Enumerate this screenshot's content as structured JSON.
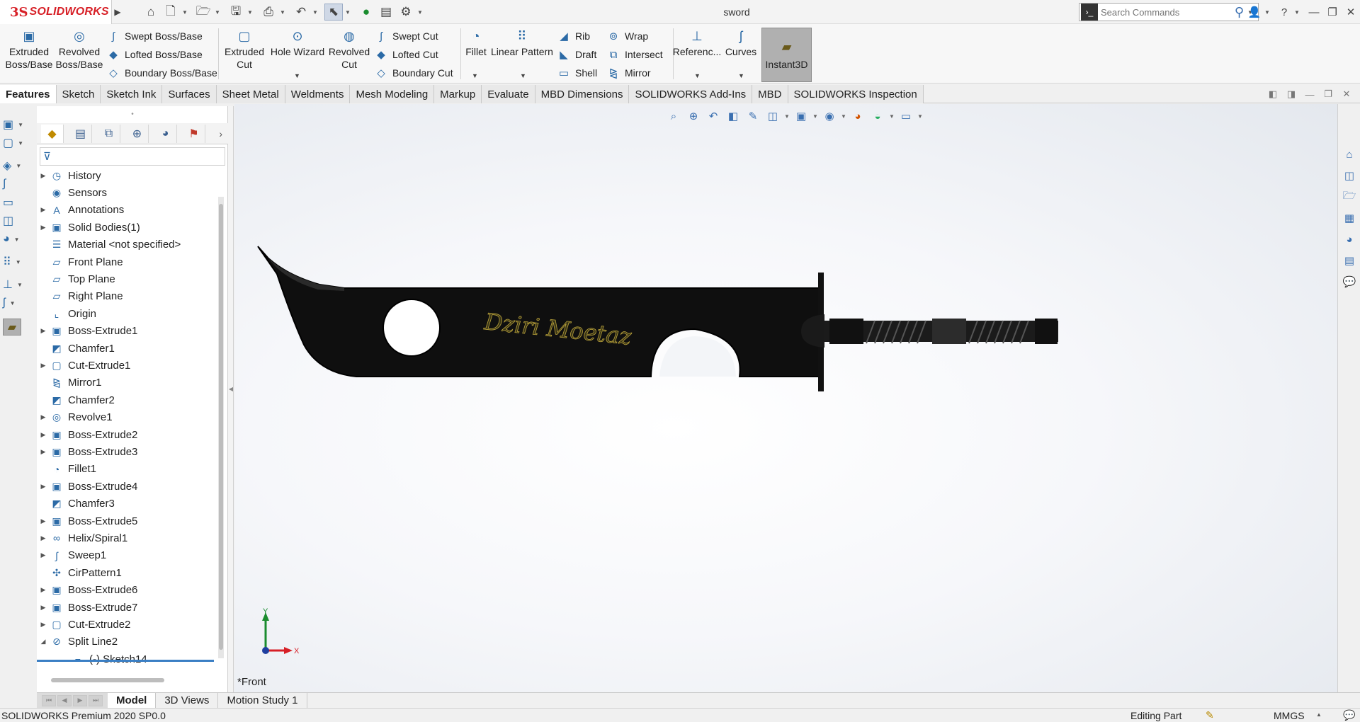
{
  "titlebar": {
    "logo_mark": "3S",
    "logo_text": "SOLIDWORKS",
    "document_title": "sword",
    "search": {
      "placeholder": "Search Commands"
    },
    "icons": [
      "home-icon",
      "new-document-icon",
      "open-icon",
      "save-icon",
      "print-icon",
      "undo-icon",
      "select-icon",
      "rebuild-icon",
      "file-properties-icon",
      "options-icon"
    ]
  },
  "ribbon": {
    "extruded_boss": "Extruded\nBoss/Base",
    "revolved_boss": "Revolved\nBoss/Base",
    "swept_boss": "Swept Boss/Base",
    "lofted_boss": "Lofted Boss/Base",
    "boundary_boss": "Boundary Boss/Base",
    "extruded_cut": "Extruded\nCut",
    "hole_wizard": "Hole Wizard",
    "revolved_cut": "Revolved\nCut",
    "swept_cut": "Swept Cut",
    "lofted_cut": "Lofted Cut",
    "boundary_cut": "Boundary Cut",
    "fillet": "Fillet",
    "linear_pattern": "Linear Pattern",
    "rib": "Rib",
    "draft": "Draft",
    "shell": "Shell",
    "wrap": "Wrap",
    "intersect": "Intersect",
    "mirror": "Mirror",
    "reference": "Referenc...",
    "curves": "Curves",
    "instant3d": "Instant3D"
  },
  "tabs": [
    "Features",
    "Sketch",
    "Sketch Ink",
    "Surfaces",
    "Sheet Metal",
    "Weldments",
    "Mesh Modeling",
    "Markup",
    "Evaluate",
    "MBD Dimensions",
    "SOLIDWORKS Add-Ins",
    "MBD",
    "SOLIDWORKS Inspection"
  ],
  "tree": [
    {
      "label": "History",
      "icon": "history-icon",
      "expandable": true
    },
    {
      "label": "Sensors",
      "icon": "sensors-icon",
      "expandable": false
    },
    {
      "label": "Annotations",
      "icon": "annotations-icon",
      "expandable": true
    },
    {
      "label": "Solid Bodies(1)",
      "icon": "solid-bodies-icon",
      "expandable": true
    },
    {
      "label": "Material <not specified>",
      "icon": "material-icon",
      "expandable": false
    },
    {
      "label": "Front Plane",
      "icon": "plane-icon",
      "expandable": false
    },
    {
      "label": "Top Plane",
      "icon": "plane-icon",
      "expandable": false
    },
    {
      "label": "Right Plane",
      "icon": "plane-icon",
      "expandable": false
    },
    {
      "label": "Origin",
      "icon": "origin-icon",
      "expandable": false
    },
    {
      "label": "Boss-Extrude1",
      "icon": "extrude-icon",
      "expandable": true
    },
    {
      "label": "Chamfer1",
      "icon": "chamfer-icon",
      "expandable": false
    },
    {
      "label": "Cut-Extrude1",
      "icon": "cut-extrude-icon",
      "expandable": true
    },
    {
      "label": "Mirror1",
      "icon": "mirror-icon",
      "expandable": false
    },
    {
      "label": "Chamfer2",
      "icon": "chamfer-icon",
      "expandable": false
    },
    {
      "label": "Revolve1",
      "icon": "revolve-icon",
      "expandable": true
    },
    {
      "label": "Boss-Extrude2",
      "icon": "extrude-icon",
      "expandable": true
    },
    {
      "label": "Boss-Extrude3",
      "icon": "extrude-icon",
      "expandable": true
    },
    {
      "label": "Fillet1",
      "icon": "fillet-icon",
      "expandable": false
    },
    {
      "label": "Boss-Extrude4",
      "icon": "extrude-icon",
      "expandable": true
    },
    {
      "label": "Chamfer3",
      "icon": "chamfer-icon",
      "expandable": false
    },
    {
      "label": "Boss-Extrude5",
      "icon": "extrude-icon",
      "expandable": true
    },
    {
      "label": "Helix/Spiral1",
      "icon": "helix-icon",
      "expandable": true
    },
    {
      "label": "Sweep1",
      "icon": "sweep-icon",
      "expandable": true
    },
    {
      "label": "CirPattern1",
      "icon": "circular-pattern-icon",
      "expandable": false
    },
    {
      "label": "Boss-Extrude6",
      "icon": "extrude-icon",
      "expandable": true
    },
    {
      "label": "Boss-Extrude7",
      "icon": "extrude-icon",
      "expandable": true
    },
    {
      "label": "Cut-Extrude2",
      "icon": "cut-extrude-icon",
      "expandable": true
    },
    {
      "label": "Split Line2",
      "icon": "split-line-icon",
      "expandable": true,
      "expanded": true
    },
    {
      "label": "(-) Sketch14",
      "icon": "sketch-icon",
      "expandable": false,
      "child": true
    }
  ],
  "viewport": {
    "engraving_text": "Dziri Moetaz",
    "view_label": "*Front",
    "axis_x": "X",
    "axis_y": "Y"
  },
  "bottom_tabs": [
    "Model",
    "3D Views",
    "Motion Study 1"
  ],
  "status": {
    "product": "SOLIDWORKS Premium 2020 SP0.0",
    "mode": "Editing Part",
    "units": "MMGS"
  },
  "colors": {
    "accent": "#2b6aa6",
    "brand_red": "#d71f26",
    "blade": "#111111"
  }
}
